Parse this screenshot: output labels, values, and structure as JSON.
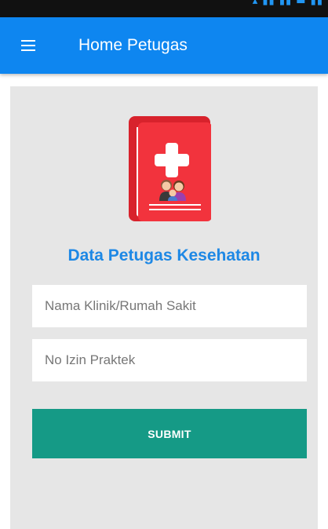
{
  "app_bar": {
    "title": "Home Petugas",
    "menu_icon": "hamburger-menu-icon",
    "color": "#0e86f0"
  },
  "main": {
    "logo_icon": "medical-book-icon",
    "heading": "Data Petugas Kesehatan",
    "heading_color": "#1e88e5",
    "fields": [
      {
        "value": "",
        "placeholder": "Nama Klinik/Rumah Sakit"
      },
      {
        "value": "",
        "placeholder": "No Izin Praktek"
      }
    ],
    "submit_label": "SUBMIT",
    "submit_color": "#159a86"
  }
}
